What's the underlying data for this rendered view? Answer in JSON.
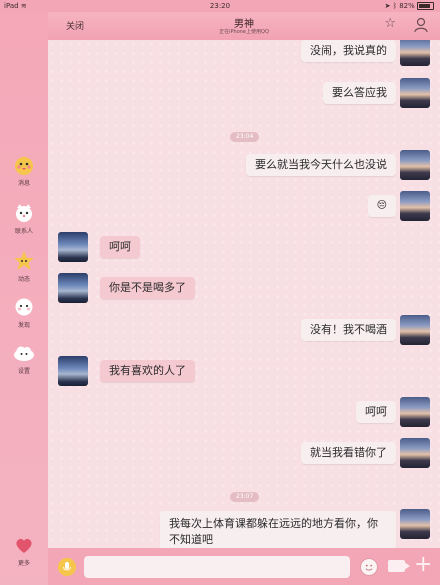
{
  "status_bar": {
    "device": "iPad",
    "wifi_icon": "wifi-icon",
    "time": "23:20",
    "location_icon": "location-arrow-icon",
    "bluetooth_icon": "bluetooth-icon",
    "battery": "82%",
    "battery_level": 0.82
  },
  "header": {
    "close_label": "关闭",
    "title": "男神",
    "subtitle": "正在iPhone上使用QQ",
    "star_icon": "star-icon",
    "person_icon": "person-icon"
  },
  "sidebar": {
    "items": [
      {
        "label": "消息",
        "icon": "chick-icon",
        "color": "#f6c64c"
      },
      {
        "label": "联系人",
        "icon": "cat-face-icon",
        "color": "#ffffff"
      },
      {
        "label": "动态",
        "icon": "star-face-icon",
        "color": "#f6c64c"
      },
      {
        "label": "发现",
        "icon": "ghost-face-icon",
        "color": "#ffffff"
      },
      {
        "label": "设置",
        "icon": "cloud-face-icon",
        "color": "#ffffff"
      },
      {
        "label": "更多",
        "icon": "heart-icon",
        "color": "#e2546b"
      }
    ]
  },
  "messages": [
    {
      "side": "right",
      "text": "没闹，我说真的"
    },
    {
      "side": "right",
      "text": "要么答应我"
    },
    {
      "type": "time",
      "text": "23:04"
    },
    {
      "side": "right",
      "text": "要么就当我今天什么也没说"
    },
    {
      "side": "right",
      "text": "😔"
    },
    {
      "side": "left",
      "text": "呵呵"
    },
    {
      "side": "left",
      "text": "你是不是喝多了"
    },
    {
      "side": "right",
      "text": "没有！我不喝酒"
    },
    {
      "side": "left",
      "text": "我有喜欢的人了"
    },
    {
      "side": "right",
      "text": "呵呵"
    },
    {
      "side": "right",
      "text": "就当我看错你了"
    },
    {
      "type": "time",
      "text": "23:07"
    },
    {
      "side": "right",
      "text": "我每次上体育课都躲在远远的地方看你，你不知道吧"
    }
  ],
  "input_bar": {
    "voice_icon": "microphone-icon",
    "emoji_icon": "smiley-icon",
    "video_icon": "video-camera-icon",
    "plus_icon": "plus-icon"
  },
  "colors": {
    "theme_pink": "#f3a7b6",
    "bubble_right": "#f7eef0",
    "bubble_left": "#f5c9d0",
    "chat_bg": "#f8dfe3"
  }
}
